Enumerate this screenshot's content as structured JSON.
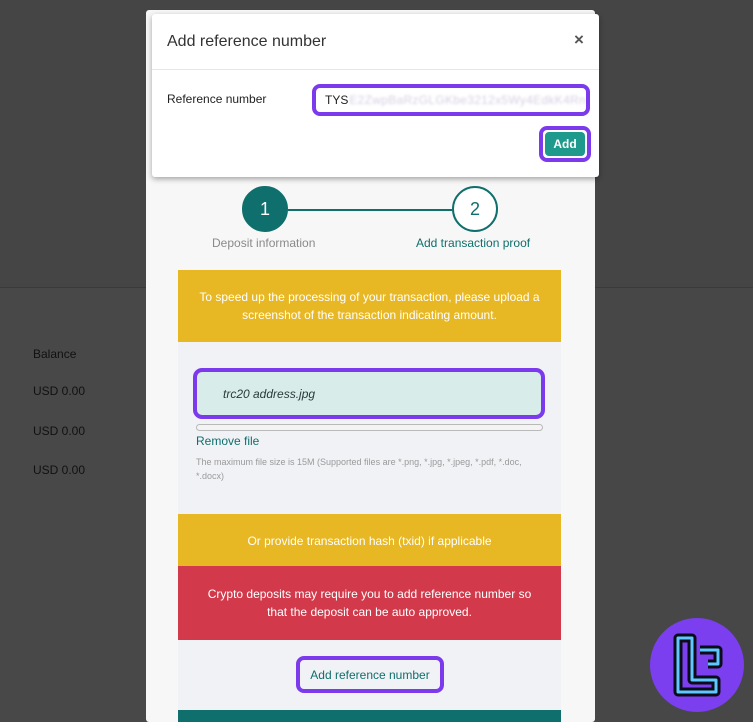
{
  "background": {
    "balance_label": "Balance",
    "rows": [
      "USD 0.00",
      "USD 0.00",
      "USD 0.00"
    ]
  },
  "stepper": {
    "steps": [
      {
        "number": "1",
        "label": "Deposit information"
      },
      {
        "number": "2",
        "label": "Add transaction proof"
      }
    ]
  },
  "upload": {
    "notice": "To speed up the processing of your transaction, please upload a screenshot of the transaction indicating amount.",
    "file_name": "trc20 address.jpg",
    "remove_label": "Remove file",
    "hint": "The maximum file size is 15M (Supported files are *.png, *.jpg, *.jpeg, *.pdf, *.doc, *.docx)"
  },
  "hash_notice": "Or provide transaction hash (txid) if applicable",
  "warning": "Crypto deposits may require you to add reference number so that the deposit can be auto approved.",
  "add_reference_button": "Add reference number",
  "dialog": {
    "title": "Add reference number",
    "close": "×",
    "field_label": "Reference number",
    "field_value_prefix": "TYS",
    "field_value_rest": "E2ZwpBaRzGLGKbe3212x5Wy4EdkK4Rn",
    "add_button": "Add"
  },
  "colors": {
    "teal": "#0f6f6c",
    "yellow": "#e7b724",
    "red": "#d23a4b",
    "highlight": "#7c3aed"
  }
}
